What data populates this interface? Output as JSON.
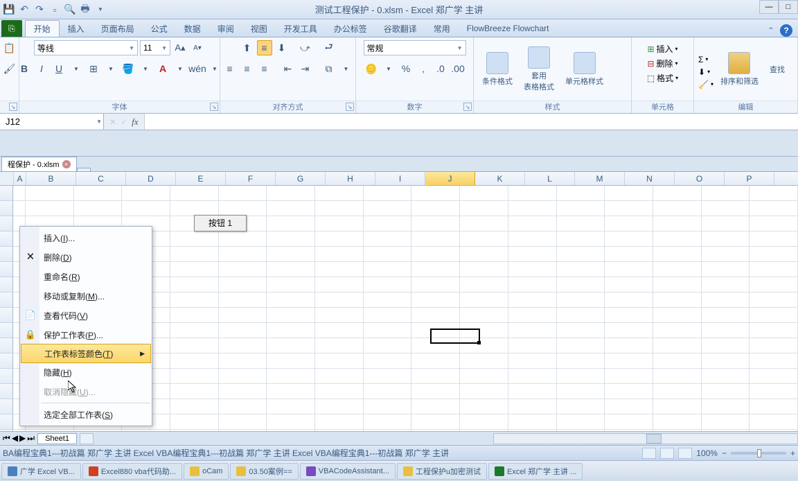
{
  "title": "测试工程保护 - 0.xlsm   -   Excel 郑广学 主讲",
  "tabs": {
    "file": "开始",
    "items": [
      "插入",
      "页面布局",
      "公式",
      "数据",
      "审阅",
      "视图",
      "开发工具",
      "办公标签",
      "谷歌翻译",
      "常用",
      "FlowBreeze Flowchart"
    ]
  },
  "ribbon": {
    "font_name": "等线",
    "font_size": "11",
    "groups": {
      "font": "字体",
      "align": "对齐方式",
      "number": "数字",
      "styles": "样式",
      "cells": "单元格",
      "editing": "编辑"
    },
    "number_format": "常规",
    "cond_fmt": "条件格式",
    "table_fmt": "套用\n表格格式",
    "cell_styles": "单元格样式",
    "insert": "插入",
    "delete": "删除",
    "format": "格式",
    "sort_filter": "排序和筛选",
    "find": "查找"
  },
  "namebox": "J12",
  "wbtab": "程保护 - 0.xlsm",
  "columns": [
    "A",
    "B",
    "C",
    "D",
    "E",
    "F",
    "G",
    "H",
    "I",
    "J",
    "K",
    "L",
    "M",
    "N",
    "O",
    "P"
  ],
  "button1": "按钮 1",
  "context_menu": {
    "insert": "插入(I)...",
    "delete": "删除(D)",
    "rename": "重命名(R)",
    "move": "移动或复制(M)...",
    "view_code": "查看代码(V)",
    "protect": "保护工作表(P)...",
    "tab_color": "工作表标签颜色(T)",
    "hide": "隐藏(H)",
    "unhide": "取消隐藏(U)...",
    "select_all": "选定全部工作表(S)"
  },
  "sheet_name": "Sheet1",
  "status_text": "BA编程宝典1---初战篇 郑广学 主讲       Excel VBA编程宝典1---初战篇 郑广学 主讲       Excel VBA编程宝典1---初战篇 郑广学 主讲",
  "zoom": "100%",
  "taskbar": [
    "广学 Excel VB...",
    "Excel880 vba代码助...",
    "oCam",
    "03.50案例==",
    "VBACodeAssistant...",
    "工程保护u加密测试",
    "Excel 郑广学 主讲 ..."
  ]
}
